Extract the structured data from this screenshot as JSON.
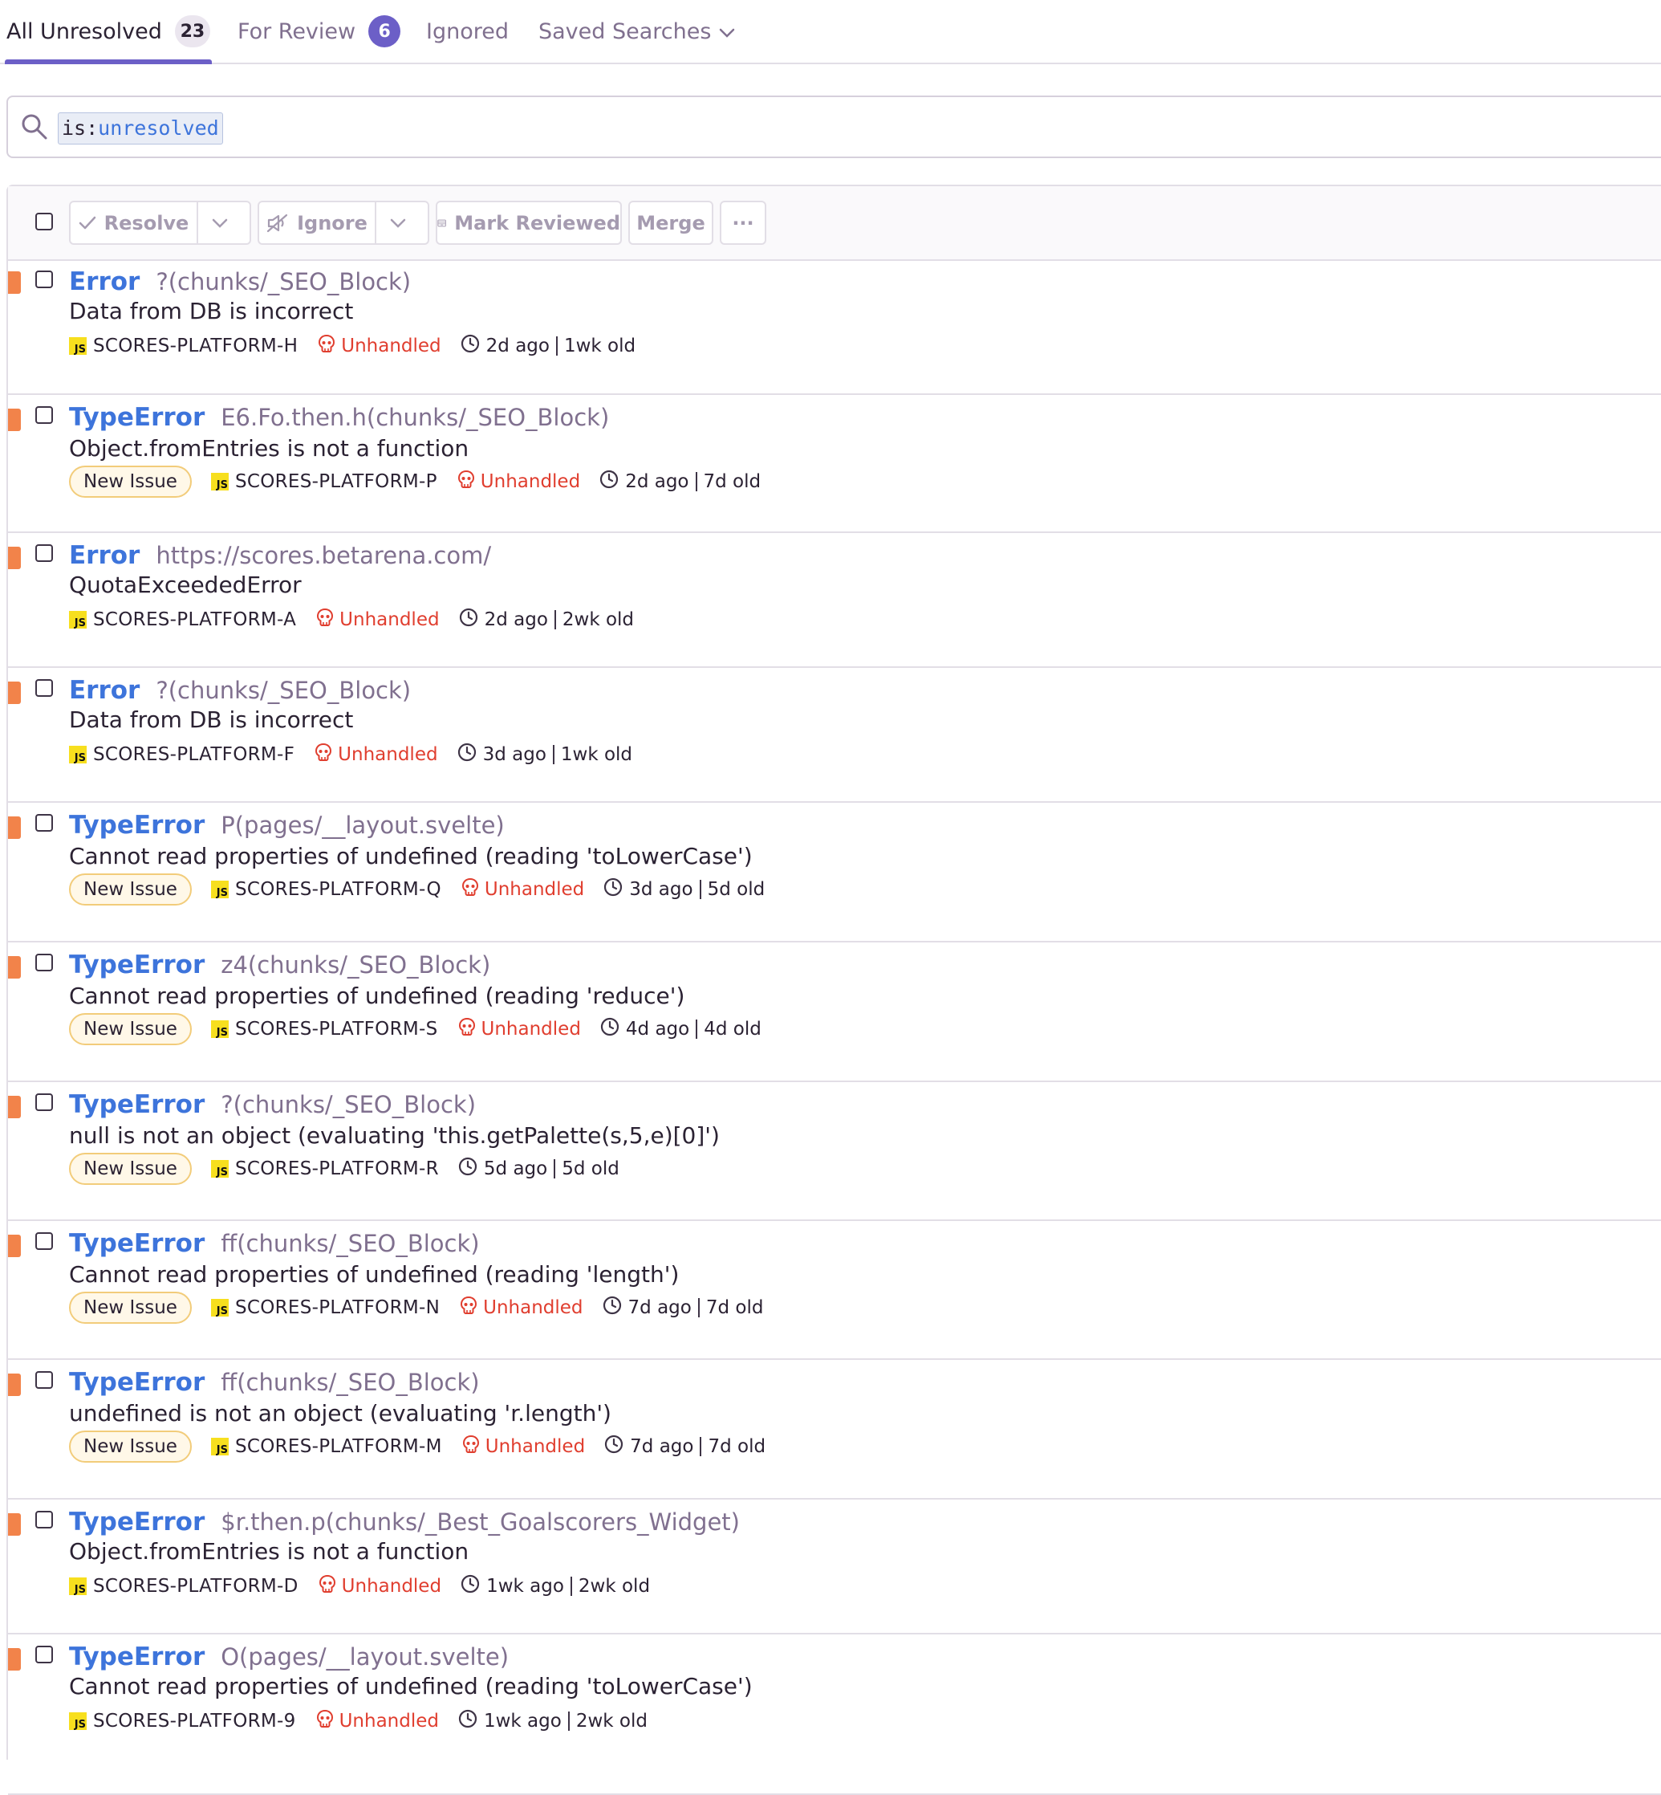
{
  "tabs": [
    {
      "label": "All Unresolved",
      "count": "23",
      "active": true
    },
    {
      "label": "For Review",
      "count": "6"
    },
    {
      "label": "Ignored"
    },
    {
      "label": "Saved Searches"
    }
  ],
  "search": {
    "query_key": "is:",
    "query_value": "unresolved"
  },
  "toolbar": {
    "resolve": "Resolve",
    "ignore": "Ignore",
    "mark_reviewed": "Mark Reviewed",
    "merge": "Merge",
    "more": "···"
  },
  "issues": [
    {
      "type": "Error",
      "location": "?(chunks/_SEO_Block)",
      "message": "Data from DB is incorrect",
      "badge": "",
      "short_id": "SCORES-PLATFORM-H",
      "unhandled": "Unhandled",
      "last_seen": "2d ago",
      "age": "1wk old"
    },
    {
      "type": "TypeError",
      "location": "E6.Fo.then.h(chunks/_SEO_Block)",
      "message": "Object.fromEntries is not a function",
      "badge": "New Issue",
      "short_id": "SCORES-PLATFORM-P",
      "unhandled": "Unhandled",
      "last_seen": "2d ago",
      "age": "7d old"
    },
    {
      "type": "Error",
      "location": "https://scores.betarena.com/",
      "message": "QuotaExceededError",
      "badge": "",
      "short_id": "SCORES-PLATFORM-A",
      "unhandled": "Unhandled",
      "last_seen": "2d ago",
      "age": "2wk old"
    },
    {
      "type": "Error",
      "location": "?(chunks/_SEO_Block)",
      "message": "Data from DB is incorrect",
      "badge": "",
      "short_id": "SCORES-PLATFORM-F",
      "unhandled": "Unhandled",
      "last_seen": "3d ago",
      "age": "1wk old"
    },
    {
      "type": "TypeError",
      "location": "P(pages/__layout.svelte)",
      "message": "Cannot read properties of undefined (reading 'toLowerCase')",
      "badge": "New Issue",
      "short_id": "SCORES-PLATFORM-Q",
      "unhandled": "Unhandled",
      "last_seen": "3d ago",
      "age": "5d old"
    },
    {
      "type": "TypeError",
      "location": "z4(chunks/_SEO_Block)",
      "message": "Cannot read properties of undefined (reading 'reduce')",
      "badge": "New Issue",
      "short_id": "SCORES-PLATFORM-S",
      "unhandled": "Unhandled",
      "last_seen": "4d ago",
      "age": "4d old"
    },
    {
      "type": "TypeError",
      "location": "?(chunks/_SEO_Block)",
      "message": "null is not an object (evaluating 'this.getPalette(s,5,e)[0]')",
      "badge": "New Issue",
      "short_id": "SCORES-PLATFORM-R",
      "unhandled": "",
      "last_seen": "5d ago",
      "age": "5d old"
    },
    {
      "type": "TypeError",
      "location": "ff(chunks/_SEO_Block)",
      "message": "Cannot read properties of undefined (reading 'length')",
      "badge": "New Issue",
      "short_id": "SCORES-PLATFORM-N",
      "unhandled": "Unhandled",
      "last_seen": "7d ago",
      "age": "7d old"
    },
    {
      "type": "TypeError",
      "location": "ff(chunks/_SEO_Block)",
      "message": "undefined is not an object (evaluating 'r.length')",
      "badge": "New Issue",
      "short_id": "SCORES-PLATFORM-M",
      "unhandled": "Unhandled",
      "last_seen": "7d ago",
      "age": "7d old"
    },
    {
      "type": "TypeError",
      "location": "$r.then.p(chunks/_Best_Goalscorers_Widget)",
      "message": "Object.fromEntries is not a function",
      "badge": "",
      "short_id": "SCORES-PLATFORM-D",
      "unhandled": "Unhandled",
      "last_seen": "1wk ago",
      "age": "2wk old"
    },
    {
      "type": "TypeError",
      "location": "O(pages/__layout.svelte)",
      "message": "Cannot read properties of undefined (reading 'toLowerCase')",
      "badge": "",
      "short_id": "SCORES-PLATFORM-9",
      "unhandled": "Unhandled",
      "last_seen": "1wk ago",
      "age": "2wk old"
    }
  ]
}
